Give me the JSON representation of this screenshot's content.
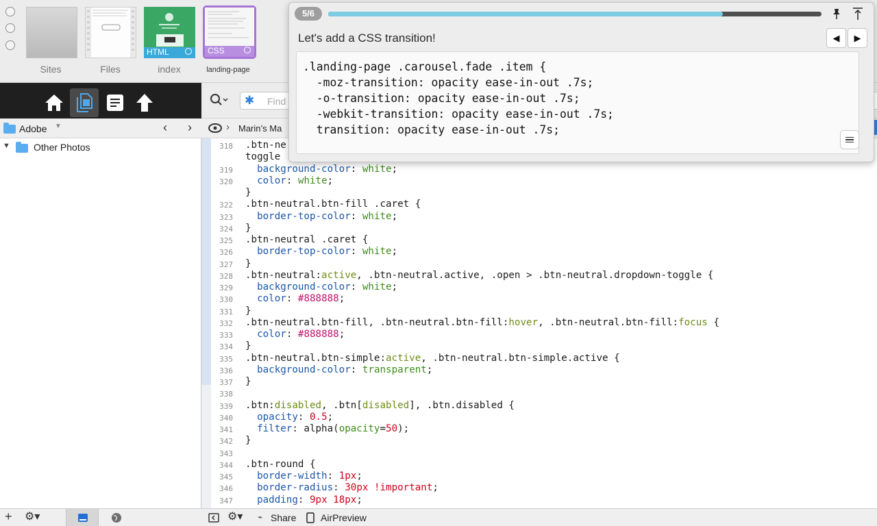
{
  "file_tabs": [
    {
      "label": "Sites"
    },
    {
      "label": "Files"
    },
    {
      "label": "index",
      "tag": "HTML"
    },
    {
      "label": "landing-page",
      "tag": "CSS"
    }
  ],
  "sidebar": {
    "location": "Adobe",
    "tree": [
      {
        "label": "Other Photos"
      }
    ]
  },
  "search": {
    "placeholder": "Find"
  },
  "breadcrumb": {
    "label": "Marin’s Ma"
  },
  "tutorial": {
    "step": "5/6",
    "progress": 0.8,
    "title": "Let's add a CSS transition!",
    "code": [
      ".landing-page .carousel.fade .item {",
      "  -moz-transition: opacity ease-in-out .7s;",
      "  -o-transition: opacity ease-in-out .7s;",
      "  -webkit-transition: opacity ease-in-out .7s;",
      "  transition: opacity ease-in-out .7s;"
    ]
  },
  "editor": {
    "lines": [
      {
        "n": "318",
        "t": ".btn-ne"
      },
      {
        "n": "",
        "t": "toggle"
      },
      {
        "n": "319",
        "t": "  background-color: white;"
      },
      {
        "n": "320",
        "t": "  color: white;"
      },
      {
        "n": "",
        "t": "}"
      },
      {
        "n": "322",
        "t": ".btn-neutral.btn-fill .caret {"
      },
      {
        "n": "323",
        "t": "  border-top-color: white;"
      },
      {
        "n": "324",
        "t": "}"
      },
      {
        "n": "325",
        "t": ".btn-neutral .caret {"
      },
      {
        "n": "326",
        "t": "  border-top-color: white;"
      },
      {
        "n": "327",
        "t": "}"
      },
      {
        "n": "328",
        "t": ".btn-neutral:active, .btn-neutral.active, .open > .btn-neutral.dropdown-toggle {"
      },
      {
        "n": "329",
        "t": "  background-color: white;"
      },
      {
        "n": "330",
        "t": "  color: #888888;"
      },
      {
        "n": "331",
        "t": "}"
      },
      {
        "n": "332",
        "t": ".btn-neutral.btn-fill, .btn-neutral.btn-fill:hover, .btn-neutral.btn-fill:focus {"
      },
      {
        "n": "333",
        "t": "  color: #888888;"
      },
      {
        "n": "334",
        "t": "}"
      },
      {
        "n": "335",
        "t": ".btn-neutral.btn-simple:active, .btn-neutral.btn-simple.active {"
      },
      {
        "n": "336",
        "t": "  background-color: transparent;"
      },
      {
        "n": "337",
        "t": "}"
      },
      {
        "n": "338",
        "t": ""
      },
      {
        "n": "339",
        "t": ".btn:disabled, .btn[disabled], .btn.disabled {"
      },
      {
        "n": "340",
        "t": "  opacity: 0.5;"
      },
      {
        "n": "341",
        "t": "  filter: alpha(opacity=50);"
      },
      {
        "n": "342",
        "t": "}"
      },
      {
        "n": "343",
        "t": ""
      },
      {
        "n": "344",
        "t": ".btn-round {"
      },
      {
        "n": "345",
        "t": "  border-width: 1px;"
      },
      {
        "n": "346",
        "t": "  border-radius: 30px !important;"
      },
      {
        "n": "347",
        "t": "  padding: 9px 18px;"
      }
    ]
  },
  "footer": {
    "share": "Share",
    "airpreview": "AirPreview"
  },
  "colors": {
    "accent": "#5aaef0",
    "html_tag": "#3aa9d9",
    "css_tag": "#b88fe0",
    "progress": "#7ecbe4"
  }
}
